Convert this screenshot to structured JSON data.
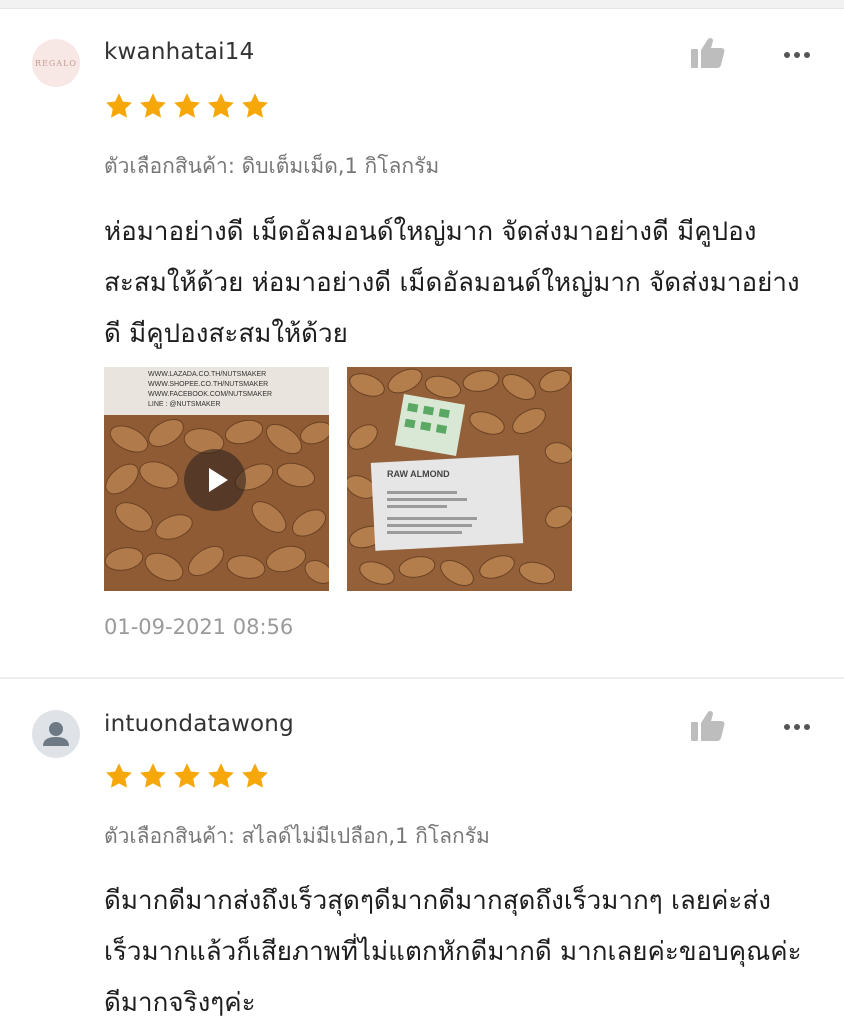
{
  "colors": {
    "star": "#f6a70a",
    "icon_gray": "#bdbdbd",
    "divider": "#eeeeee"
  },
  "reviews": [
    {
      "username": "kwanhatai14",
      "avatar_logo_text": "REGALO",
      "rating": 5,
      "variant": "ตัวเลือกสินค้า: ดิบเต็มเม็ด,1 กิโลกรัม",
      "comment": "ห่อมาอย่างดี เม็ดอัลมอนด์ใหญ่มาก จัดส่งมาอย่างดี มีคูปองสะสมให้ด้วย ห่อมาอย่างดี เม็ดอัลมอนด์ใหญ่มาก จัดส่งมาอย่างดี มีคูปองสะสมให้ด้วย",
      "media": [
        {
          "type": "video",
          "label_lines": [
            "WWW.LAZADA.CO.TH/NUTSMAKER",
            "WWW.SHOPEE.CO.TH/NUTSMAKER",
            "WWW.FACEBOOK.COM/NUTSMAKER",
            "LINE : @NUTSMAKER"
          ]
        },
        {
          "type": "image",
          "label_title": "RAW ALMOND"
        }
      ],
      "timestamp": "01-09-2021 08:56"
    },
    {
      "username": "intuondatawong",
      "rating": 5,
      "variant": "ตัวเลือกสินค้า: สไลด์ไม่มีเปลือก,1 กิโลกรัม",
      "comment": "ดีมากดีมากส่งถึงเร็วสุดๆดีมากดีมากสุดถึงเร็วมากๆ เลยค่ะส่งเร็วมากแล้วก็เสียภาพที่ไม่แตกหักดีมากดี มากเลยค่ะขอบคุณค่ะดีมากจริงๆค่ะ"
    }
  ]
}
